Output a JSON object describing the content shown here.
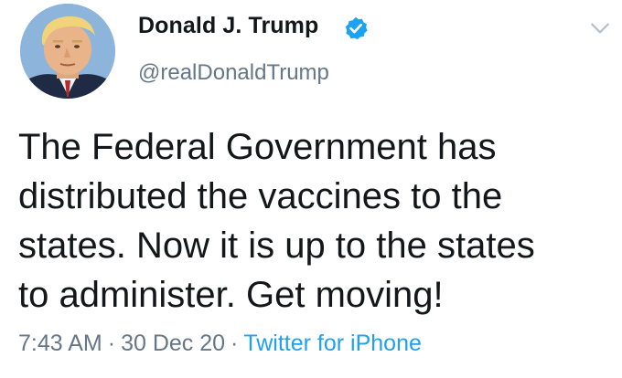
{
  "tweet": {
    "author": {
      "name": "Donald J. Trump",
      "handle": "@realDonaldTrump",
      "verified": true,
      "avatar_icon": "profile-photo"
    },
    "text": "The Federal Government has\ndistributed the vaccines to the\nstates. Now it is up to the states\nto administer. Get moving!",
    "time": "7:43 AM",
    "separator": "·",
    "date": "30 Dec 20",
    "source": "Twitter for iPhone",
    "menu_icon": "chevron-down-icon"
  },
  "colors": {
    "text": "#14171a",
    "secondary": "#657786",
    "accent": "#1da1f2",
    "background": "#ffffff"
  }
}
